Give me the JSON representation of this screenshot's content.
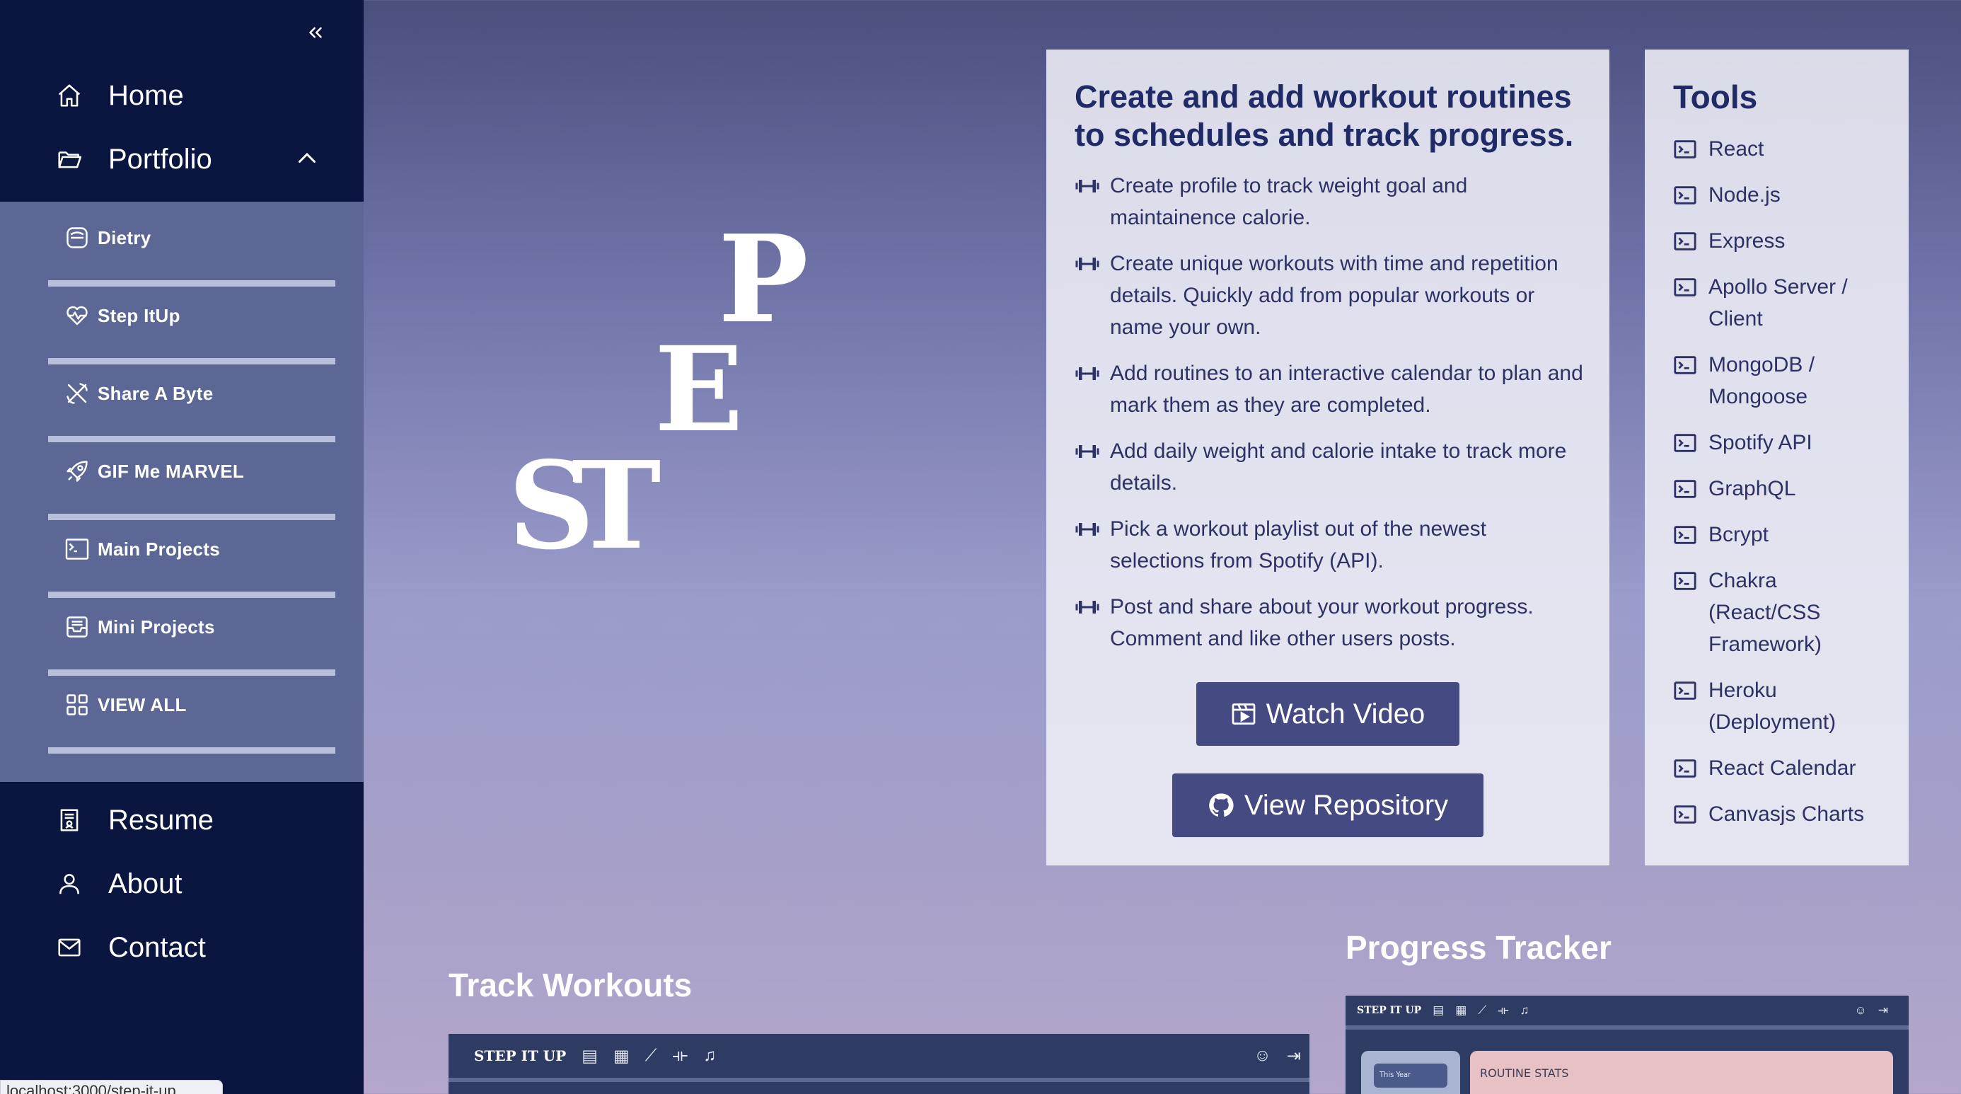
{
  "sidebar": {
    "collapse_icon": "double-chevron-left-icon",
    "top_items": [
      {
        "label": "Home",
        "icon": "home-icon"
      },
      {
        "label": "Portfolio",
        "icon": "folder-open-icon"
      }
    ],
    "submenu": [
      {
        "label": "Dietry",
        "icon": "bowl-icon"
      },
      {
        "label": "Step ItUp",
        "icon": "heart-pulse-icon"
      },
      {
        "label": "Share A Byte",
        "icon": "utensils-icon"
      },
      {
        "label": "GIF Me MARVEL",
        "icon": "rocket-icon"
      },
      {
        "label": "Main Projects",
        "icon": "terminal-icon"
      },
      {
        "label": "Mini Projects",
        "icon": "inbox-icon"
      },
      {
        "label": "VIEW ALL",
        "icon": "grid-icon"
      }
    ],
    "bottom_items": [
      {
        "label": "Resume",
        "icon": "resume-icon"
      },
      {
        "label": "About",
        "icon": "user-icon"
      },
      {
        "label": "Contact",
        "icon": "mail-icon"
      }
    ]
  },
  "logo": {
    "letters": [
      "S",
      "T",
      "E",
      "P"
    ]
  },
  "description": {
    "heading": "Create and add workout routines to schedules and track progress.",
    "features": [
      "Create profile to track weight goal and maintainence calorie.",
      "Create unique workouts with time and repetition details. Quickly add from popular workouts or name your own.",
      "Add routines to an interactive calendar to plan and mark them as they are completed.",
      "Add daily weight and calorie intake to track more details.",
      "Pick a workout playlist out of the newest selections from Spotify (API).",
      "Post and share about your workout progress. Comment and like other users posts."
    ],
    "feature_icon": "dumbbell-icon",
    "watch_label": "Watch Video",
    "repo_label": "View Repository"
  },
  "tools": {
    "title": "Tools",
    "items": [
      "React",
      "Node.js",
      "Express",
      "Apollo Server / Client",
      "MongoDB / Mongoose",
      "Spotify API",
      "GraphQL",
      "Bcrypt",
      "Chakra (React/CSS Framework)",
      "Heroku (Deployment)",
      "React Calendar",
      "Canvasjs Charts"
    ]
  },
  "sections": {
    "track_title": "Track Workouts",
    "progress_title": "Progress Tracker",
    "preview_logo": "STEP IT UP",
    "progress_filter": "This Year",
    "progress_stats": "ROUTINE STATS"
  },
  "status_url": "localhost:3000/step-it-up"
}
